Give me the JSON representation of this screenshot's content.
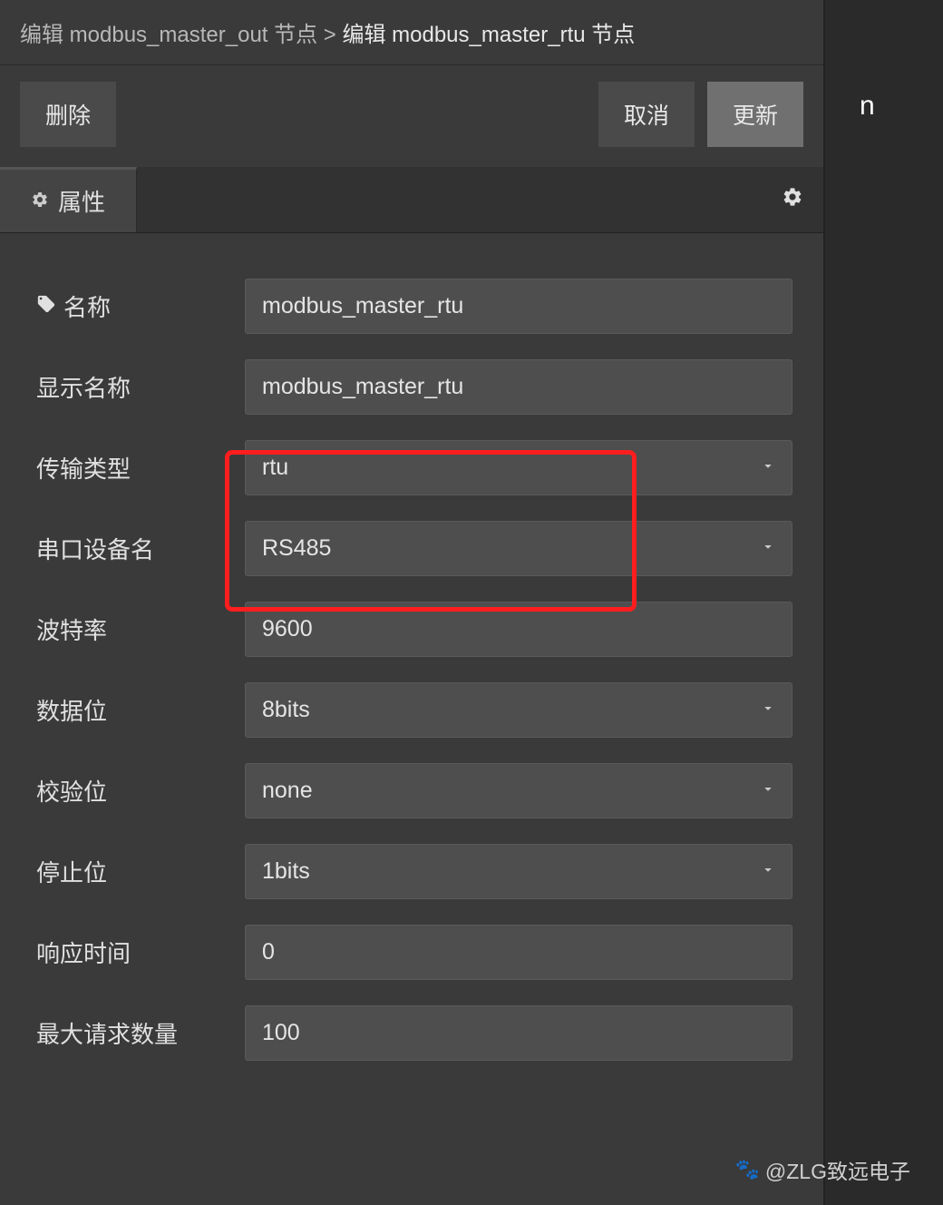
{
  "breadcrumb": {
    "parent": "编辑 modbus_master_out 节点",
    "separator": ">",
    "current": "编辑 modbus_master_rtu 节点"
  },
  "toolbar": {
    "delete_label": "删除",
    "cancel_label": "取消",
    "update_label": "更新"
  },
  "tab": {
    "label": "属性"
  },
  "form": {
    "name": {
      "label": "名称",
      "value": "modbus_master_rtu"
    },
    "display_name": {
      "label": "显示名称",
      "value": "modbus_master_rtu"
    },
    "transport_type": {
      "label": "传输类型",
      "value": "rtu"
    },
    "serial_device": {
      "label": "串口设备名",
      "value": "RS485"
    },
    "baud_rate": {
      "label": "波特率",
      "value": "9600"
    },
    "data_bits": {
      "label": "数据位",
      "value": "8bits"
    },
    "parity": {
      "label": "校验位",
      "value": "none"
    },
    "stop_bits": {
      "label": "停止位",
      "value": "1bits"
    },
    "response_time": {
      "label": "响应时间",
      "value": "0"
    },
    "max_requests": {
      "label": "最大请求数量",
      "value": "100"
    }
  },
  "watermark": "@ZLG致远电子",
  "right_strip": "n"
}
